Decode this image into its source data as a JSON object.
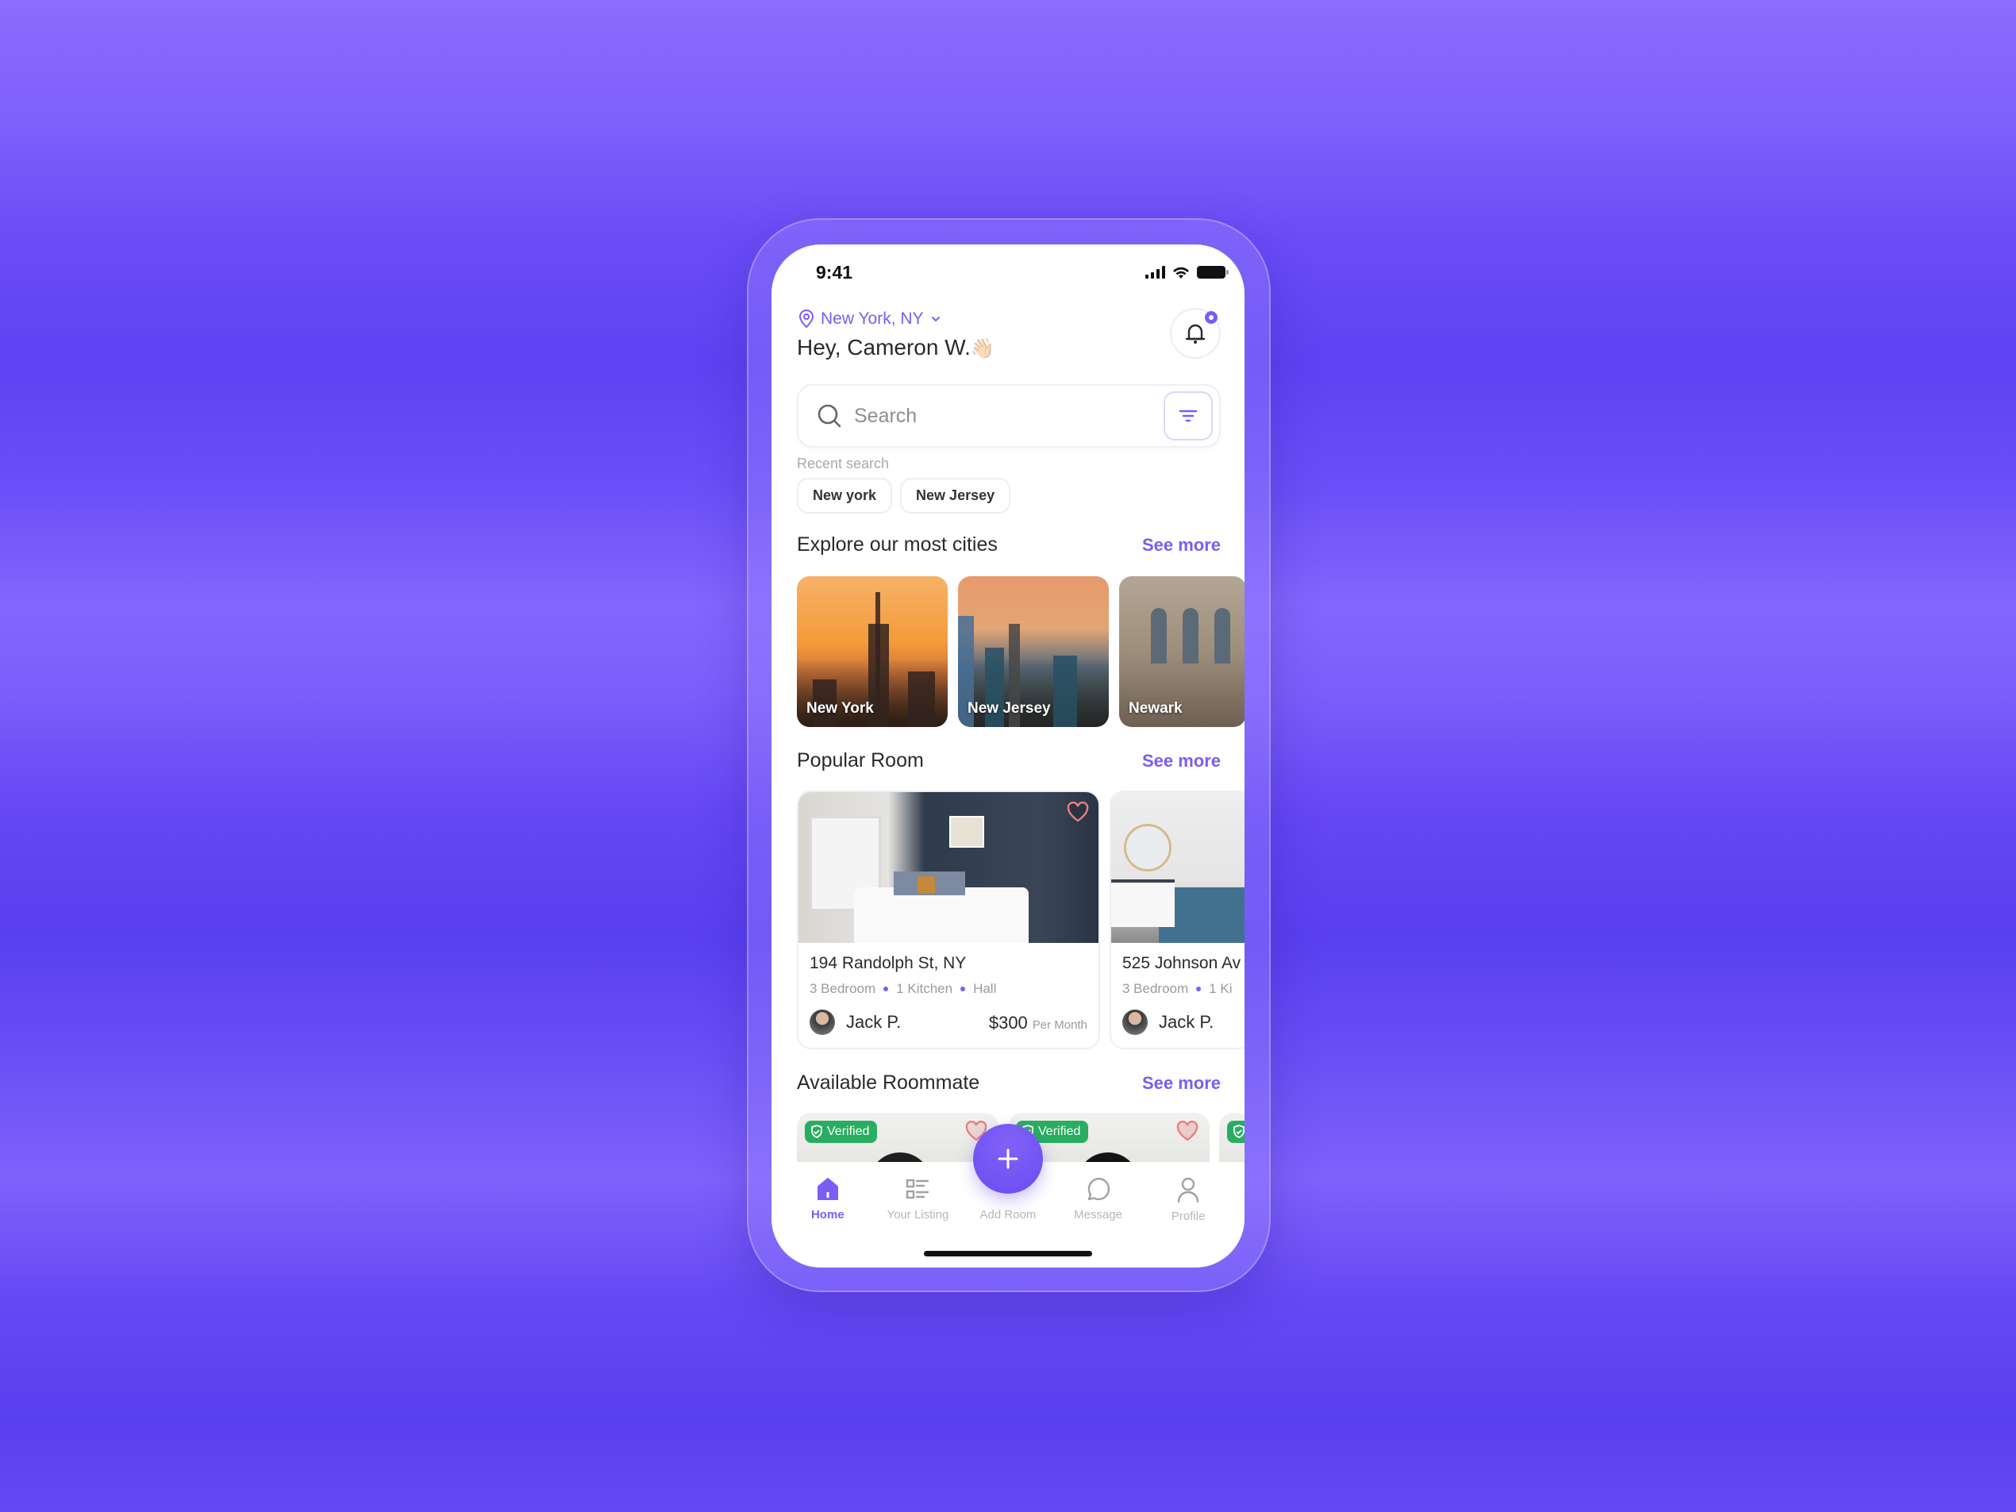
{
  "status_bar": {
    "time": "9:41"
  },
  "header": {
    "location": "New York, NY",
    "greeting": "Hey, Cameron W.",
    "greeting_emoji": "👋🏻"
  },
  "search": {
    "placeholder": "Search",
    "value": ""
  },
  "recent_search": {
    "label": "Recent search",
    "chips": [
      "New york",
      "New Jersey"
    ]
  },
  "cities_section": {
    "title": "Explore our most cities",
    "see_more": "See more",
    "cities": [
      {
        "name": "New York"
      },
      {
        "name": "New Jersey"
      },
      {
        "name": "Newark"
      }
    ]
  },
  "rooms_section": {
    "title": "Popular Room",
    "see_more": "See more",
    "rooms": [
      {
        "address": "194 Randolph St, NY",
        "features": [
          "3 Bedroom",
          "1 Kitchen",
          "Hall"
        ],
        "owner": "Jack P.",
        "price": "$300",
        "price_unit": "Per Month",
        "favorited": false
      },
      {
        "address": "525 Johnson Av",
        "features": [
          "3 Bedroom",
          "1 Ki"
        ],
        "owner": "Jack P."
      }
    ]
  },
  "roommates_section": {
    "title": "Available Roommate",
    "see_more": "See more",
    "badge": "Verified",
    "count_visible": 3
  },
  "bottom_nav": {
    "items": [
      {
        "label": "Home",
        "icon": "home-icon",
        "active": true
      },
      {
        "label": "Your Listing",
        "icon": "listing-icon",
        "active": false
      },
      {
        "label": "Add Room",
        "icon": "plus-icon",
        "active": false
      },
      {
        "label": "Message",
        "icon": "message-icon",
        "active": false
      },
      {
        "label": "Profile",
        "icon": "profile-icon",
        "active": false
      }
    ]
  },
  "colors": {
    "accent": "#7b5cf5",
    "verified": "#27ae60",
    "text": "#2a2a2a",
    "muted": "#9a9aa0",
    "heart": "#e8807e"
  }
}
